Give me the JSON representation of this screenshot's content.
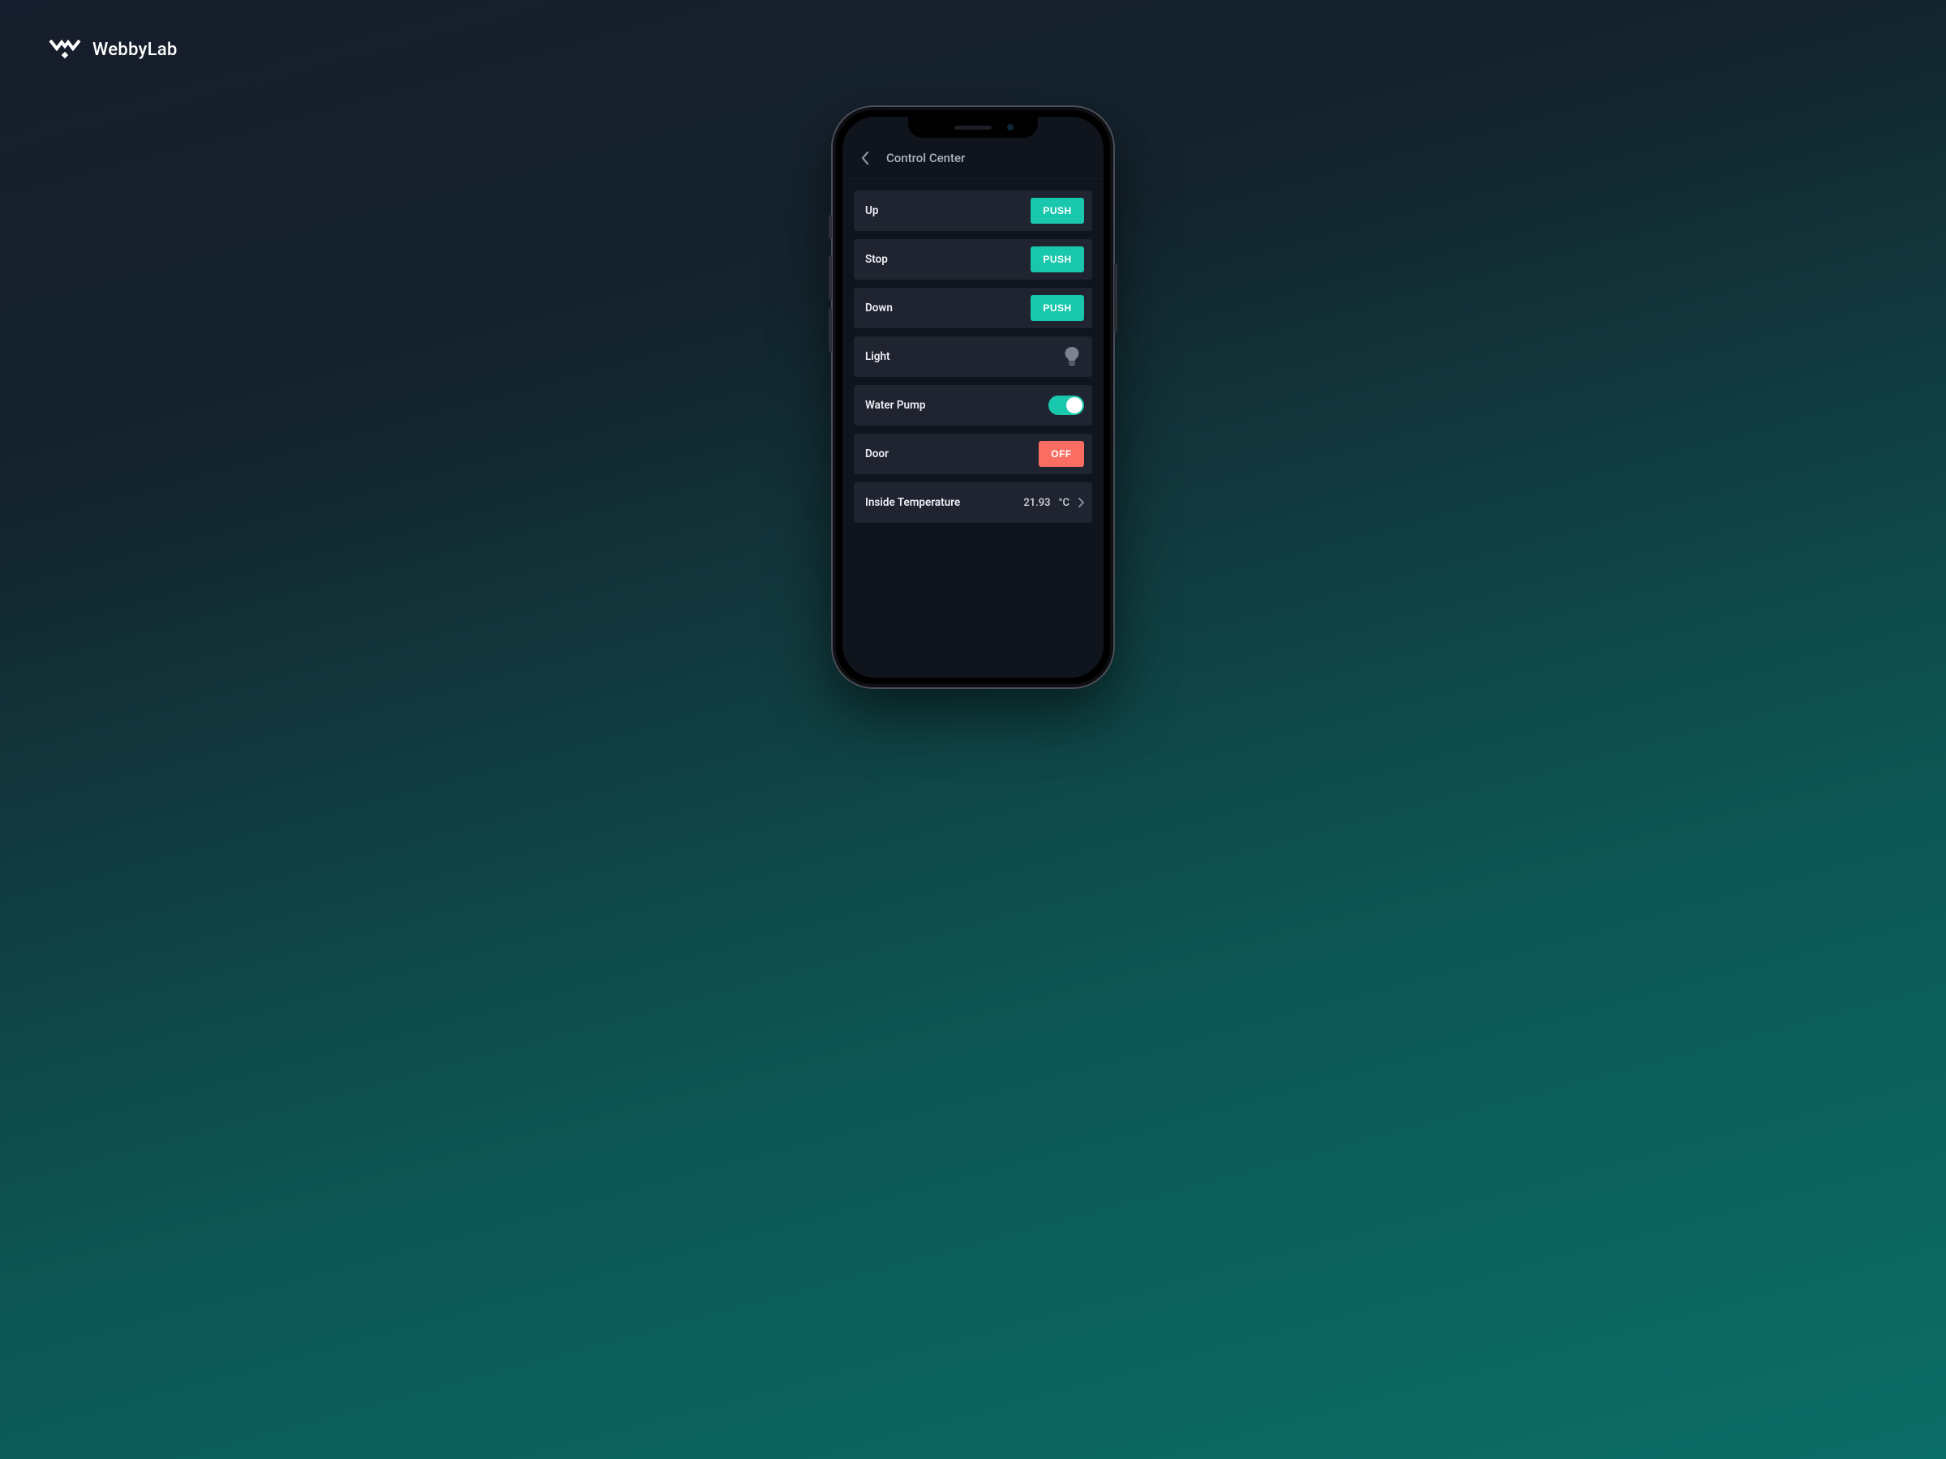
{
  "brand": {
    "name": "WebbyLab"
  },
  "header": {
    "title": "Control Center"
  },
  "rows": {
    "up": {
      "label": "Up",
      "button": "PUSH"
    },
    "stop": {
      "label": "Stop",
      "button": "PUSH"
    },
    "down": {
      "label": "Down",
      "button": "PUSH"
    },
    "light": {
      "label": "Light"
    },
    "pump": {
      "label": "Water Pump",
      "state": "on"
    },
    "door": {
      "label": "Door",
      "button": "OFF"
    },
    "temp": {
      "label": "Inside Temperature",
      "value": "21.93",
      "unit": "°C"
    }
  },
  "colors": {
    "accent": "#19c7ad",
    "danger": "#f96d63",
    "card": "#1f2430",
    "screen": "#10141c"
  }
}
